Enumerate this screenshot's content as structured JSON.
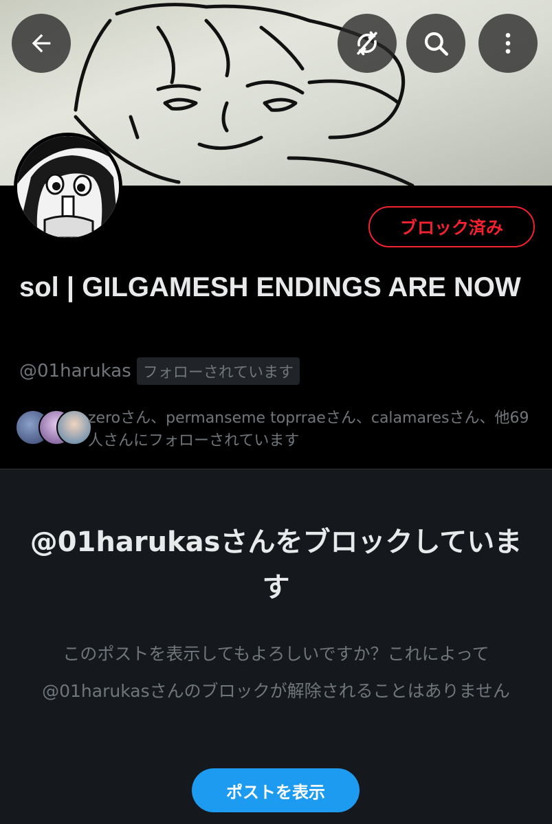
{
  "header": {
    "back_icon": "arrow-left-icon",
    "sync_icon": "no-sync-icon",
    "search_icon": "search-icon",
    "more_icon": "more-vertical-icon"
  },
  "profile": {
    "blocked_label": "ブロック済み",
    "display_name": "sol | GILGAMESH ENDINGS ARE NOW",
    "handle": "@01harukas",
    "follows_you_label": "フォローされています",
    "followed_by_text": "zeroさん、permanseme toprraeさん、calamaresさん、他69人さんにフォローされています"
  },
  "blocked_notice": {
    "title": "@01harukasさんをブロックしています",
    "description": "このポストを表示してもよろしいですか？これによって@01harukasさんのブロックが解除されることはありません",
    "show_post_label": "ポストを表示"
  },
  "colors": {
    "danger": "#f4212e",
    "accent": "#1d9bf0",
    "muted_text": "#71767b",
    "panel_bg": "#15181c"
  }
}
